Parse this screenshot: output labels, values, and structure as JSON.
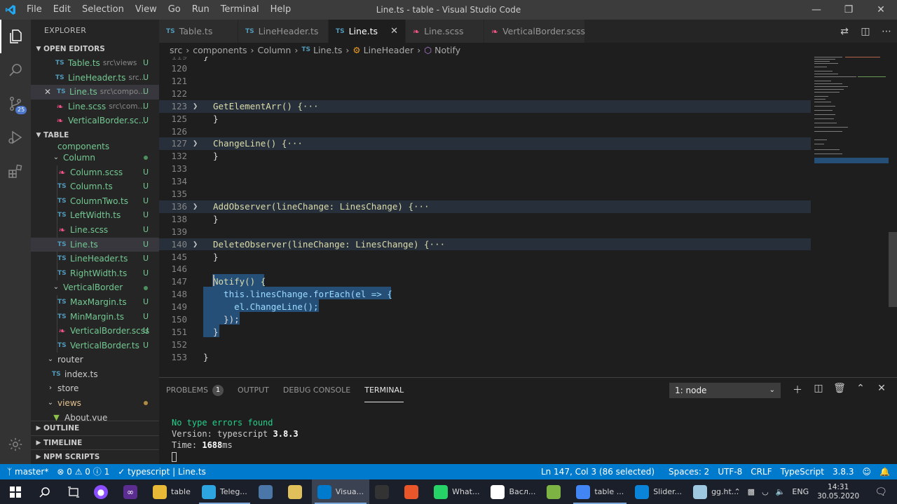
{
  "window": {
    "title": "Line.ts - table - Visual Studio Code",
    "menu": [
      "File",
      "Edit",
      "Selection",
      "View",
      "Go",
      "Run",
      "Terminal",
      "Help"
    ]
  },
  "activity": {
    "scm_badge": "25"
  },
  "sidebar": {
    "title": "EXPLORER",
    "open_editors_label": "OPEN EDITORS",
    "open_editors": [
      {
        "name": "Table.ts",
        "dir": "src\\views",
        "status": "U",
        "icon": "ts"
      },
      {
        "name": "LineHeader.ts",
        "dir": "src...",
        "status": "U",
        "icon": "ts"
      },
      {
        "name": "Line.ts",
        "dir": "src\\compo...",
        "status": "U",
        "icon": "ts"
      },
      {
        "name": "Line.scss",
        "dir": "src\\com...",
        "status": "U",
        "icon": "scss"
      },
      {
        "name": "VerticalBorder.sc...",
        "dir": "",
        "status": "U",
        "icon": "scss"
      }
    ],
    "workspace_label": "TABLE",
    "tree": {
      "components": "components",
      "column_folder": "Column",
      "column_files": [
        {
          "name": "Column.scss",
          "status": "U",
          "icon": "scss"
        },
        {
          "name": "Column.ts",
          "status": "U",
          "icon": "ts"
        },
        {
          "name": "ColumnTwo.ts",
          "status": "U",
          "icon": "ts"
        },
        {
          "name": "LeftWidth.ts",
          "status": "U",
          "icon": "ts"
        },
        {
          "name": "Line.scss",
          "status": "U",
          "icon": "scss"
        },
        {
          "name": "Line.ts",
          "status": "U",
          "icon": "ts"
        },
        {
          "name": "LineHeader.ts",
          "status": "U",
          "icon": "ts"
        },
        {
          "name": "RightWidth.ts",
          "status": "U",
          "icon": "ts"
        }
      ],
      "vb_folder": "VerticalBorder",
      "vb_files": [
        {
          "name": "MaxMargin.ts",
          "status": "U",
          "icon": "ts"
        },
        {
          "name": "MinMargin.ts",
          "status": "U",
          "icon": "ts"
        },
        {
          "name": "VerticalBorder.scss",
          "status": "U",
          "icon": "scss"
        },
        {
          "name": "VerticalBorder.ts",
          "status": "U",
          "icon": "ts"
        }
      ],
      "router": "router",
      "index": "index.ts",
      "store": "store",
      "views": "views",
      "about": "About.vue"
    },
    "outline_label": "OUTLINE",
    "timeline_label": "TIMELINE",
    "npm_label": "NPM SCRIPTS"
  },
  "tabs": [
    {
      "label": "Table.ts",
      "icon": "ts"
    },
    {
      "label": "LineHeader.ts",
      "icon": "ts"
    },
    {
      "label": "Line.ts",
      "icon": "ts"
    },
    {
      "label": "Line.scss",
      "icon": "scss"
    },
    {
      "label": "VerticalBorder.scss",
      "icon": "scss"
    }
  ],
  "breadcrumb": {
    "parts": [
      "src",
      "components",
      "Column"
    ],
    "file": "Line.ts",
    "class": "LineHeader",
    "method": "Notify"
  },
  "editor": {
    "lines": [
      {
        "n": "120",
        "fold": "",
        "code": ""
      },
      {
        "n": "121",
        "fold": "",
        "code": ""
      },
      {
        "n": "122",
        "fold": "",
        "code": ""
      },
      {
        "n": "123",
        "fold": ">",
        "code": "GetElementArr() {···"
      },
      {
        "n": "125",
        "fold": "",
        "code": "}"
      },
      {
        "n": "126",
        "fold": "",
        "code": ""
      },
      {
        "n": "127",
        "fold": ">",
        "code": "ChangeLine() {···"
      },
      {
        "n": "132",
        "fold": "",
        "code": "}"
      },
      {
        "n": "133",
        "fold": "",
        "code": ""
      },
      {
        "n": "134",
        "fold": "",
        "code": ""
      },
      {
        "n": "135",
        "fold": "",
        "code": ""
      },
      {
        "n": "136",
        "fold": ">",
        "code": "AddObserver(lineChange: LinesChange) {···"
      },
      {
        "n": "138",
        "fold": "",
        "code": "}"
      },
      {
        "n": "139",
        "fold": "",
        "code": ""
      },
      {
        "n": "140",
        "fold": ">",
        "code": "DeleteObserver(lineChange: LinesChange) {···"
      },
      {
        "n": "145",
        "fold": "",
        "code": "}"
      },
      {
        "n": "146",
        "fold": "",
        "code": ""
      },
      {
        "n": "147",
        "fold": "",
        "code": "Notify() {"
      },
      {
        "n": "148",
        "fold": "",
        "code": "  this.linesChange.forEach(el => {"
      },
      {
        "n": "149",
        "fold": "",
        "code": "    el.ChangeLine();"
      },
      {
        "n": "150",
        "fold": "",
        "code": "  });"
      },
      {
        "n": "151",
        "fold": "",
        "code": "}"
      },
      {
        "n": "152",
        "fold": "",
        "code": ""
      },
      {
        "n": "153",
        "fold": "",
        "code": "}"
      }
    ]
  },
  "panel": {
    "tabs": [
      "PROBLEMS",
      "OUTPUT",
      "DEBUG CONSOLE",
      "TERMINAL"
    ],
    "problems_count": "1",
    "terminal_select": "1: node",
    "terminal": {
      "line1": "No type errors found",
      "line2_prefix": "Version: typescript ",
      "line2_value": "3.8.3",
      "line3_prefix": "Time: ",
      "line3_value": "1688",
      "line3_suffix": "ms"
    }
  },
  "statusbar": {
    "branch": "master*",
    "errors": "0",
    "warnings": "0",
    "info": "1",
    "ts_check": "typescript | Line.ts",
    "position": "Ln 147, Col 3 (86 selected)",
    "spaces": "Spaces: 2",
    "encoding": "UTF-8",
    "eol": "CRLF",
    "language": "TypeScript",
    "ts_version": "3.8.3"
  },
  "taskbar": {
    "apps": [
      {
        "label": "table",
        "color": "#e8b936"
      },
      {
        "label": "Teleg...",
        "color": "#2ca5e0"
      },
      {
        "label": "",
        "color": "#4a76a8"
      },
      {
        "label": "",
        "color": "#e0c05a"
      },
      {
        "label": "Visua...",
        "color": "#007acc"
      },
      {
        "label": "",
        "color": "#333333"
      },
      {
        "label": "",
        "color": "#e8562a"
      },
      {
        "label": "What...",
        "color": "#25d366"
      },
      {
        "label": "Васл...",
        "color": "#ffffff"
      },
      {
        "label": "",
        "color": "#7cb342"
      },
      {
        "label": "table ...",
        "color": "#4285f4"
      },
      {
        "label": "Slider...",
        "color": "#0a84d8"
      },
      {
        "label": "gg.ht...",
        "color": "#9ec7e0"
      }
    ],
    "lang": "ENG",
    "time": "14:31",
    "date": "30.05.2020"
  }
}
